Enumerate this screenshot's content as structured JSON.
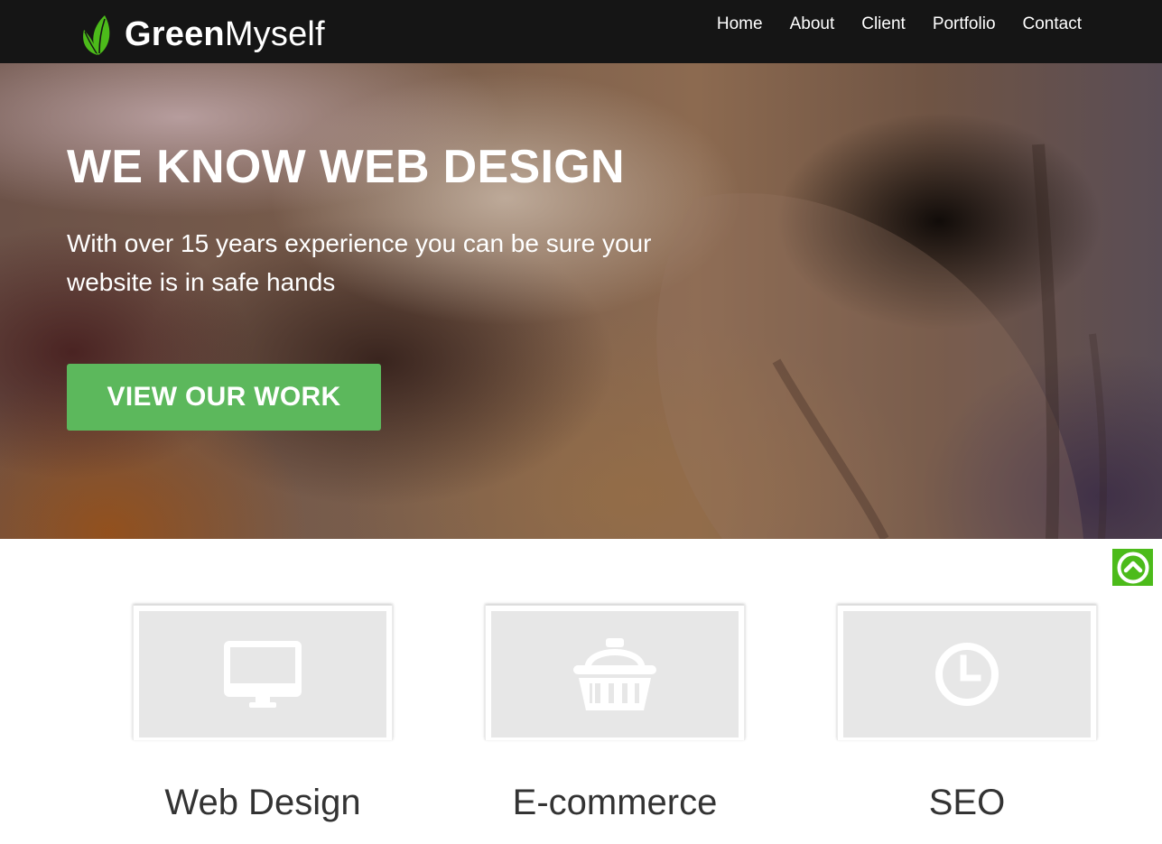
{
  "brand": {
    "name_bold": "Green",
    "name_light": "Myself",
    "icon": "leaf-icon",
    "leaf_color": "#4cbb1a"
  },
  "nav": {
    "items": [
      {
        "label": "Home"
      },
      {
        "label": "About"
      },
      {
        "label": "Client"
      },
      {
        "label": "Portfolio"
      },
      {
        "label": "Contact"
      }
    ]
  },
  "hero": {
    "title": "WE KNOW WEB DESIGN",
    "subtitle": "With over 15 years experience you can be sure your website is in safe hands",
    "button_label": "VIEW OUR WORK",
    "button_color": "#5cb85c"
  },
  "back_to_top": {
    "icon": "chevron-up-icon",
    "color": "#4cbb1a"
  },
  "services": [
    {
      "title": "Web Design",
      "icon": "monitor-icon"
    },
    {
      "title": "E-commerce",
      "icon": "shopping-basket-icon"
    },
    {
      "title": "SEO",
      "icon": "clock-icon"
    }
  ]
}
